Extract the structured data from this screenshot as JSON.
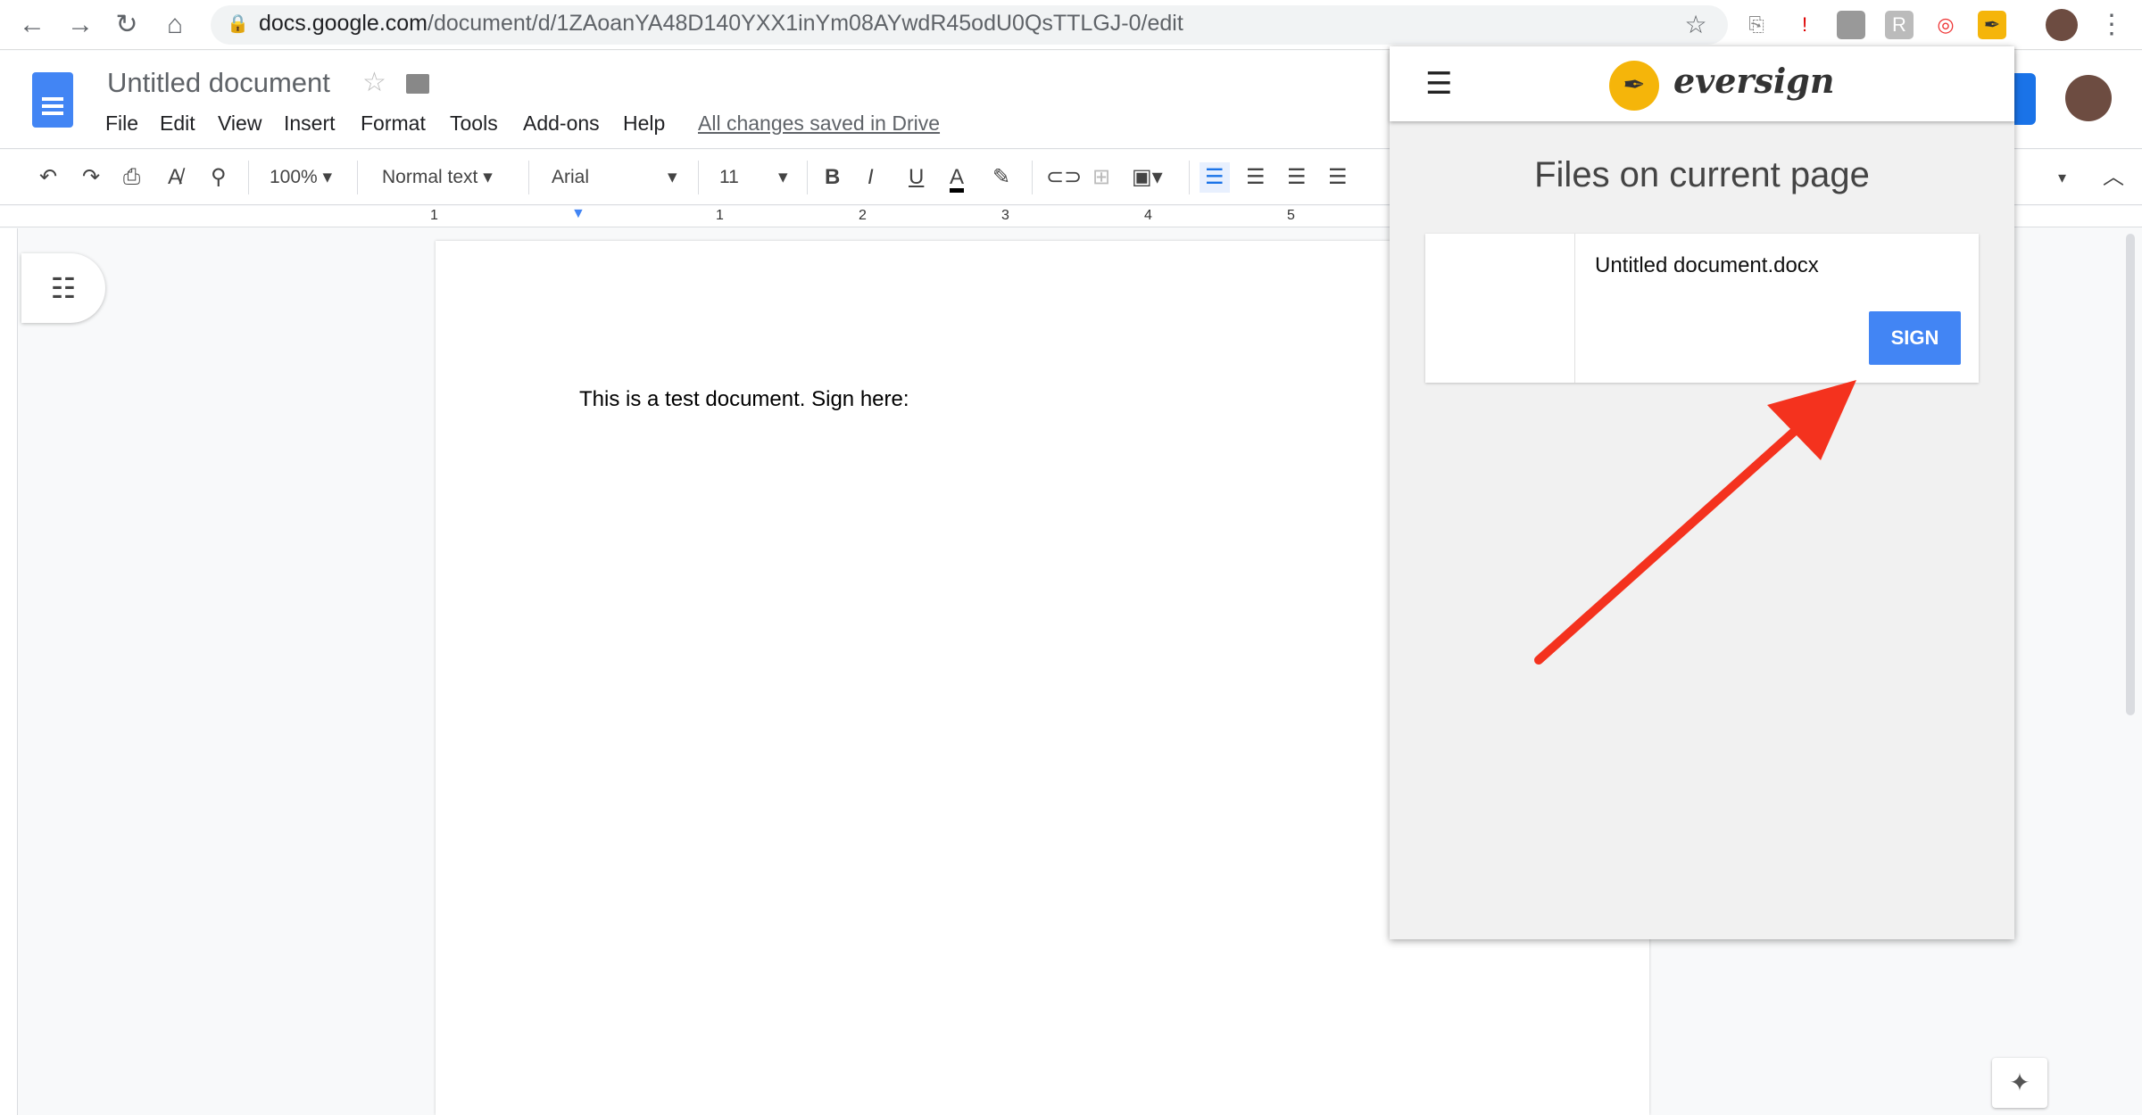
{
  "browser": {
    "url_host": "docs.google.com",
    "url_path": "/document/d/1ZAoanYA48D140YXX1inYm08AYwdR45odU0QsTTLGJ-0/edit"
  },
  "docs": {
    "title": "Untitled document",
    "menu": [
      "File",
      "Edit",
      "View",
      "Insert",
      "Format",
      "Tools",
      "Add-ons",
      "Help"
    ],
    "saved_status": "All changes saved in Drive"
  },
  "toolbar": {
    "zoom": "100%",
    "style": "Normal text",
    "font": "Arial",
    "size": "11"
  },
  "ruler": {
    "labels": [
      "1",
      "1",
      "2",
      "3",
      "4",
      "5"
    ]
  },
  "document": {
    "body_text": "This is a test document. Sign here:"
  },
  "panel": {
    "brand": "eversign",
    "heading": "Files on current page",
    "file_name": "Untitled document.docx",
    "sign_label": "SIGN",
    "accent": "#4285f4",
    "logo_color": "#f5b50a"
  },
  "annotation": {
    "arrow_color": "#f4321e"
  }
}
